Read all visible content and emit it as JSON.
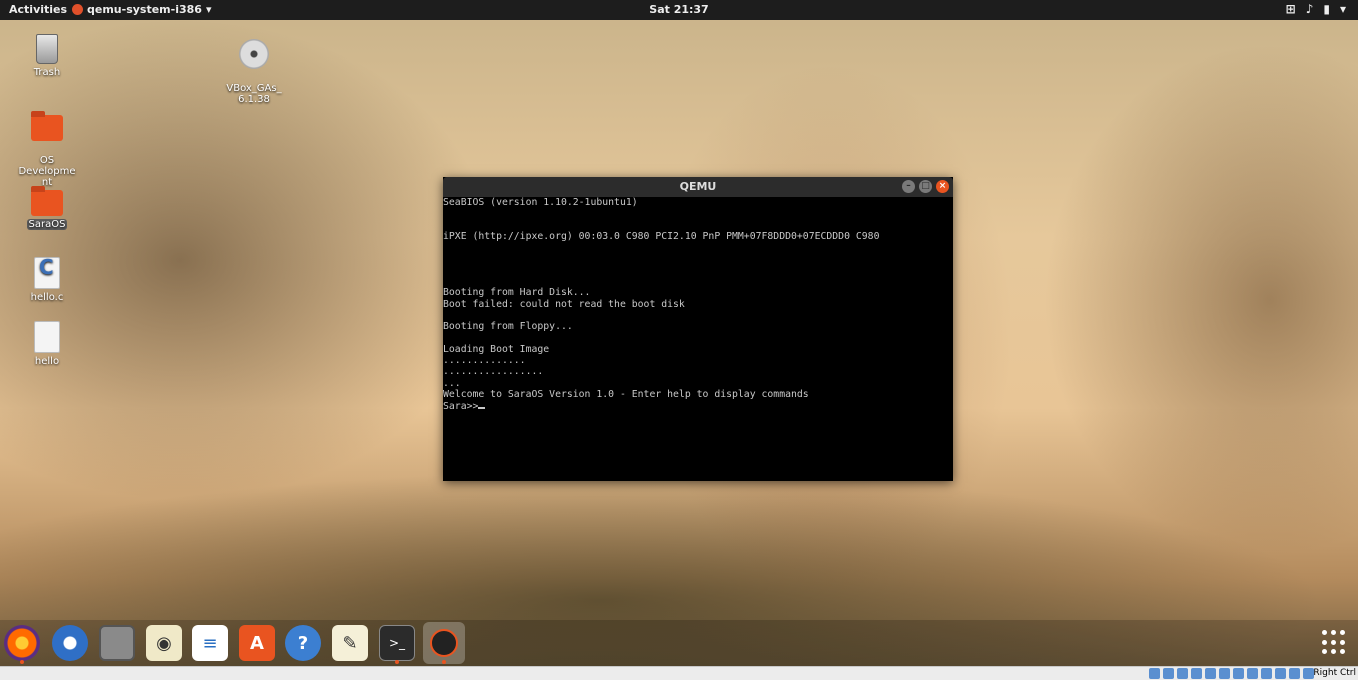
{
  "topbar": {
    "activities": "Activities",
    "app_name": "qemu-system-i386",
    "app_arrow": "▾",
    "clock": "Sat 21:37"
  },
  "desktop": {
    "trash": "Trash",
    "vbox": "VBox_GAs_\n6.1.38",
    "osdev": "OS\nDevelopme\nnt",
    "saraos": "SaraOS",
    "helloc": "hello.c",
    "hello": "hello"
  },
  "qemu": {
    "title": "QEMU",
    "screen_text": "SeaBIOS (version 1.10.2-1ubuntu1)\n\n\niPXE (http://ipxe.org) 00:03.0 C980 PCI2.10 PnP PMM+07F8DDD0+07ECDDD0 C980\n\n\n\n\nBooting from Hard Disk...\nBoot failed: could not read the boot disk\n\nBooting from Floppy...\n\nLoading Boot Image\n..............\n.................\n...\nWelcome to SaraOS Version 1.0 - Enter help to display commands\nSara>>"
  },
  "statusbar": {
    "host_key": "Right Ctrl"
  },
  "icons": {
    "firefox": "firefox-icon",
    "thunderbird": "thunderbird-icon",
    "files": "files-icon",
    "rhythmbox": "rhythmbox-icon",
    "writer": "libreoffice-writer-icon",
    "software": "software-center-icon",
    "help": "help-icon",
    "text_editor": "text-editor-icon",
    "terminal": "terminal-icon",
    "qemu": "qemu-icon"
  },
  "colors": {
    "accent": "#e95420",
    "topbar": "#1d1d1d"
  }
}
